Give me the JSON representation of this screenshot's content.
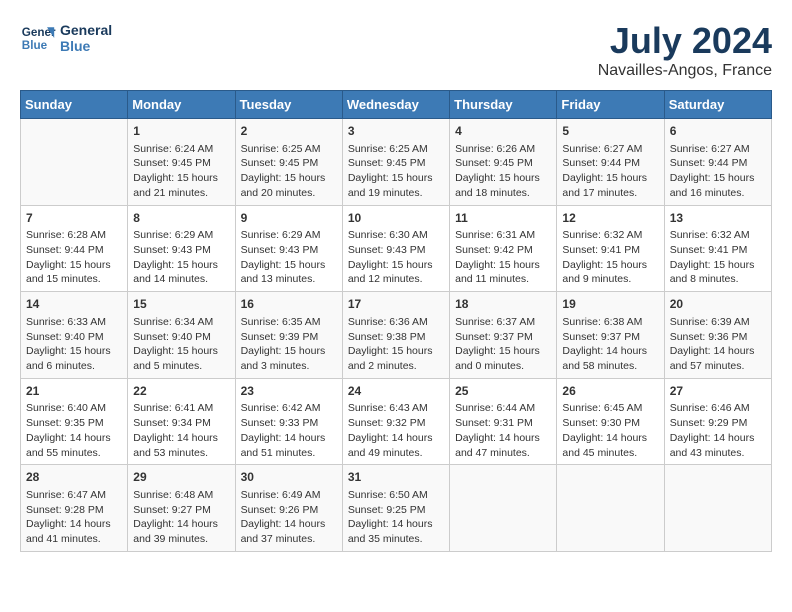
{
  "header": {
    "logo_line1": "General",
    "logo_line2": "Blue",
    "month": "July 2024",
    "location": "Navailles-Angos, France"
  },
  "weekdays": [
    "Sunday",
    "Monday",
    "Tuesday",
    "Wednesday",
    "Thursday",
    "Friday",
    "Saturday"
  ],
  "weeks": [
    [
      {
        "day": "",
        "content": ""
      },
      {
        "day": "1",
        "content": "Sunrise: 6:24 AM\nSunset: 9:45 PM\nDaylight: 15 hours\nand 21 minutes."
      },
      {
        "day": "2",
        "content": "Sunrise: 6:25 AM\nSunset: 9:45 PM\nDaylight: 15 hours\nand 20 minutes."
      },
      {
        "day": "3",
        "content": "Sunrise: 6:25 AM\nSunset: 9:45 PM\nDaylight: 15 hours\nand 19 minutes."
      },
      {
        "day": "4",
        "content": "Sunrise: 6:26 AM\nSunset: 9:45 PM\nDaylight: 15 hours\nand 18 minutes."
      },
      {
        "day": "5",
        "content": "Sunrise: 6:27 AM\nSunset: 9:44 PM\nDaylight: 15 hours\nand 17 minutes."
      },
      {
        "day": "6",
        "content": "Sunrise: 6:27 AM\nSunset: 9:44 PM\nDaylight: 15 hours\nand 16 minutes."
      }
    ],
    [
      {
        "day": "7",
        "content": "Sunrise: 6:28 AM\nSunset: 9:44 PM\nDaylight: 15 hours\nand 15 minutes."
      },
      {
        "day": "8",
        "content": "Sunrise: 6:29 AM\nSunset: 9:43 PM\nDaylight: 15 hours\nand 14 minutes."
      },
      {
        "day": "9",
        "content": "Sunrise: 6:29 AM\nSunset: 9:43 PM\nDaylight: 15 hours\nand 13 minutes."
      },
      {
        "day": "10",
        "content": "Sunrise: 6:30 AM\nSunset: 9:43 PM\nDaylight: 15 hours\nand 12 minutes."
      },
      {
        "day": "11",
        "content": "Sunrise: 6:31 AM\nSunset: 9:42 PM\nDaylight: 15 hours\nand 11 minutes."
      },
      {
        "day": "12",
        "content": "Sunrise: 6:32 AM\nSunset: 9:41 PM\nDaylight: 15 hours\nand 9 minutes."
      },
      {
        "day": "13",
        "content": "Sunrise: 6:32 AM\nSunset: 9:41 PM\nDaylight: 15 hours\nand 8 minutes."
      }
    ],
    [
      {
        "day": "14",
        "content": "Sunrise: 6:33 AM\nSunset: 9:40 PM\nDaylight: 15 hours\nand 6 minutes."
      },
      {
        "day": "15",
        "content": "Sunrise: 6:34 AM\nSunset: 9:40 PM\nDaylight: 15 hours\nand 5 minutes."
      },
      {
        "day": "16",
        "content": "Sunrise: 6:35 AM\nSunset: 9:39 PM\nDaylight: 15 hours\nand 3 minutes."
      },
      {
        "day": "17",
        "content": "Sunrise: 6:36 AM\nSunset: 9:38 PM\nDaylight: 15 hours\nand 2 minutes."
      },
      {
        "day": "18",
        "content": "Sunrise: 6:37 AM\nSunset: 9:37 PM\nDaylight: 15 hours\nand 0 minutes."
      },
      {
        "day": "19",
        "content": "Sunrise: 6:38 AM\nSunset: 9:37 PM\nDaylight: 14 hours\nand 58 minutes."
      },
      {
        "day": "20",
        "content": "Sunrise: 6:39 AM\nSunset: 9:36 PM\nDaylight: 14 hours\nand 57 minutes."
      }
    ],
    [
      {
        "day": "21",
        "content": "Sunrise: 6:40 AM\nSunset: 9:35 PM\nDaylight: 14 hours\nand 55 minutes."
      },
      {
        "day": "22",
        "content": "Sunrise: 6:41 AM\nSunset: 9:34 PM\nDaylight: 14 hours\nand 53 minutes."
      },
      {
        "day": "23",
        "content": "Sunrise: 6:42 AM\nSunset: 9:33 PM\nDaylight: 14 hours\nand 51 minutes."
      },
      {
        "day": "24",
        "content": "Sunrise: 6:43 AM\nSunset: 9:32 PM\nDaylight: 14 hours\nand 49 minutes."
      },
      {
        "day": "25",
        "content": "Sunrise: 6:44 AM\nSunset: 9:31 PM\nDaylight: 14 hours\nand 47 minutes."
      },
      {
        "day": "26",
        "content": "Sunrise: 6:45 AM\nSunset: 9:30 PM\nDaylight: 14 hours\nand 45 minutes."
      },
      {
        "day": "27",
        "content": "Sunrise: 6:46 AM\nSunset: 9:29 PM\nDaylight: 14 hours\nand 43 minutes."
      }
    ],
    [
      {
        "day": "28",
        "content": "Sunrise: 6:47 AM\nSunset: 9:28 PM\nDaylight: 14 hours\nand 41 minutes."
      },
      {
        "day": "29",
        "content": "Sunrise: 6:48 AM\nSunset: 9:27 PM\nDaylight: 14 hours\nand 39 minutes."
      },
      {
        "day": "30",
        "content": "Sunrise: 6:49 AM\nSunset: 9:26 PM\nDaylight: 14 hours\nand 37 minutes."
      },
      {
        "day": "31",
        "content": "Sunrise: 6:50 AM\nSunset: 9:25 PM\nDaylight: 14 hours\nand 35 minutes."
      },
      {
        "day": "",
        "content": ""
      },
      {
        "day": "",
        "content": ""
      },
      {
        "day": "",
        "content": ""
      }
    ]
  ]
}
